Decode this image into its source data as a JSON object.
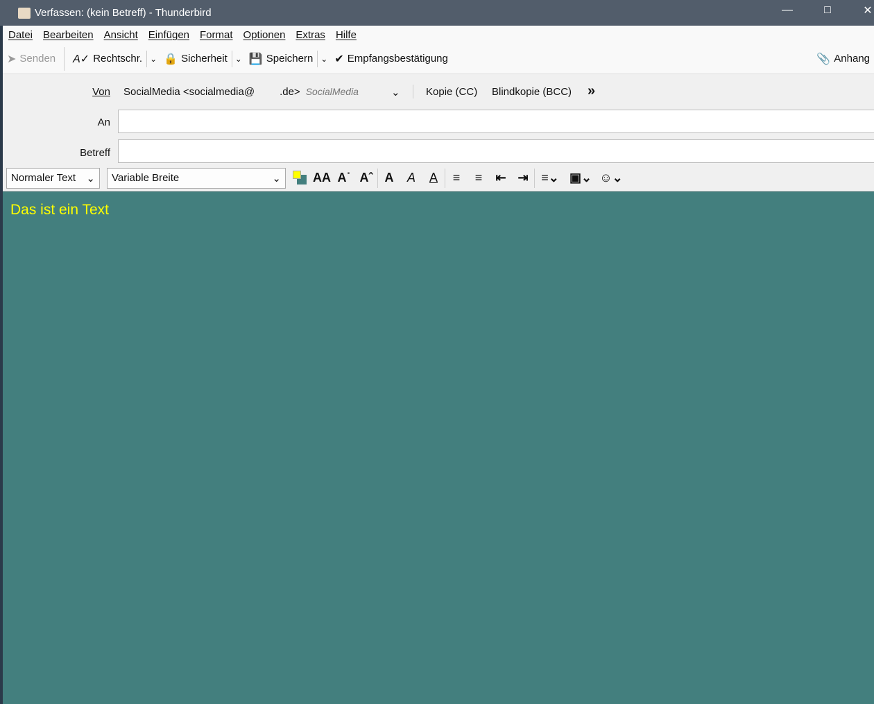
{
  "window": {
    "title": "Verfassen: (kein Betreff) - Thunderbird"
  },
  "menu": [
    "Datei",
    "Bearbeiten",
    "Ansicht",
    "Einfügen",
    "Format",
    "Optionen",
    "Extras",
    "Hilfe"
  ],
  "toolbar": {
    "send": "Senden",
    "spelling": "Rechtschr.",
    "security": "Sicherheit",
    "save": "Speichern",
    "receipt": "Empfangsbestätigung",
    "attach": "Anhang"
  },
  "header": {
    "from_label": "Von",
    "from_value": "SocialMedia <socialmedia@",
    "from_domain": ".de>",
    "from_identity": "SocialMedia",
    "cc": "Kopie (CC)",
    "bcc": "Blindkopie (BCC)",
    "to_label": "An",
    "to_value": "",
    "subject_label": "Betreff",
    "subject_value": ""
  },
  "format": {
    "paragraph": "Normaler Text",
    "font": "Variable Breite",
    "text_color": "#ffff00",
    "bg_color": "#437f7e"
  },
  "body": {
    "text": "Das ist ein Text"
  }
}
